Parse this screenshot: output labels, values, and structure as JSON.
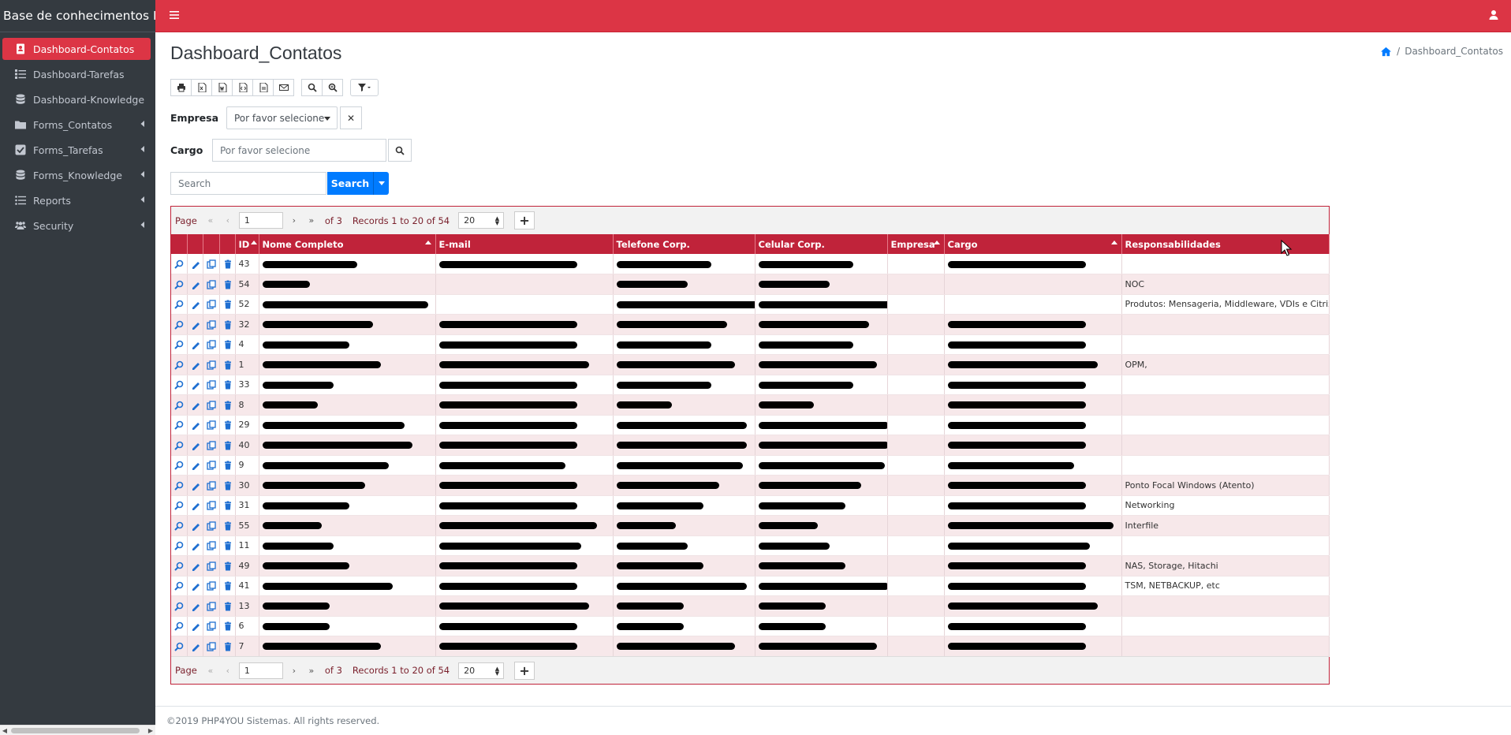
{
  "app": {
    "brand": "Base de conhecimentos PHP"
  },
  "sidebar": {
    "items": [
      {
        "label": "Dashboard-Contatos",
        "icon": "address-book-icon",
        "active": true,
        "submenu": false
      },
      {
        "label": "Dashboard-Tarefas",
        "icon": "tasks-icon",
        "active": false,
        "submenu": false
      },
      {
        "label": "Dashboard-Knowledge",
        "icon": "database-icon",
        "active": false,
        "submenu": false
      },
      {
        "label": "Forms_Contatos",
        "icon": "folder-icon",
        "active": false,
        "submenu": true
      },
      {
        "label": "Forms_Tarefas",
        "icon": "check-square-icon",
        "active": false,
        "submenu": true
      },
      {
        "label": "Forms_Knowledge",
        "icon": "database-icon",
        "active": false,
        "submenu": true
      },
      {
        "label": "Reports",
        "icon": "list-icon",
        "active": false,
        "submenu": true
      },
      {
        "label": "Security",
        "icon": "users-icon",
        "active": false,
        "submenu": true
      }
    ]
  },
  "header": {
    "title": "Dashboard_Contatos",
    "breadcrumb": "Dashboard_Contatos",
    "breadcrumb_sep": "/"
  },
  "filters": {
    "empresa_label": "Empresa",
    "empresa_value": "Por favor selecione",
    "empresa_clear": "✕",
    "cargo_label": "Cargo",
    "cargo_value": "Por favor selecione",
    "search_placeholder": "Search",
    "search_button": "Search"
  },
  "pager": {
    "page_label": "Page",
    "page_value": "1",
    "of_text": "of 3",
    "records_text": "Records 1 to 20 of 54",
    "page_size": "20",
    "add_symbol": "+"
  },
  "table": {
    "columns": [
      "ID",
      "Nome Completo",
      "E-mail",
      "Telefone Corp.",
      "Celular Corp.",
      "Empresa",
      "Cargo",
      "Responsabilidades"
    ],
    "rows": [
      {
        "id": "43",
        "resp": ""
      },
      {
        "id": "54",
        "resp": "NOC"
      },
      {
        "id": "52",
        "resp": "Produtos: Mensageria, Middleware, VDIs e Citrix."
      },
      {
        "id": "32",
        "resp": ""
      },
      {
        "id": "4",
        "resp": ""
      },
      {
        "id": "1",
        "resp": "OPM,"
      },
      {
        "id": "33",
        "resp": ""
      },
      {
        "id": "8",
        "resp": ""
      },
      {
        "id": "29",
        "resp": ""
      },
      {
        "id": "40",
        "resp": ""
      },
      {
        "id": "9",
        "resp": ""
      },
      {
        "id": "30",
        "resp": "Ponto Focal Windows (Atento)"
      },
      {
        "id": "31",
        "resp": "Networking"
      },
      {
        "id": "55",
        "resp": "Interfile"
      },
      {
        "id": "11",
        "resp": ""
      },
      {
        "id": "49",
        "resp": "NAS, Storage, Hitachi"
      },
      {
        "id": "41",
        "resp": "TSM, NETBACKUP, etc"
      },
      {
        "id": "13",
        "resp": ""
      },
      {
        "id": "6",
        "resp": ""
      },
      {
        "id": "7",
        "resp": ""
      }
    ]
  },
  "footer": {
    "text": "©2019 PHP4YOU Sistemas. All rights reserved."
  },
  "colors": {
    "accent": "#dc3545",
    "header": "#c0233a",
    "sidebar": "#343a40",
    "primary": "#007bff"
  }
}
